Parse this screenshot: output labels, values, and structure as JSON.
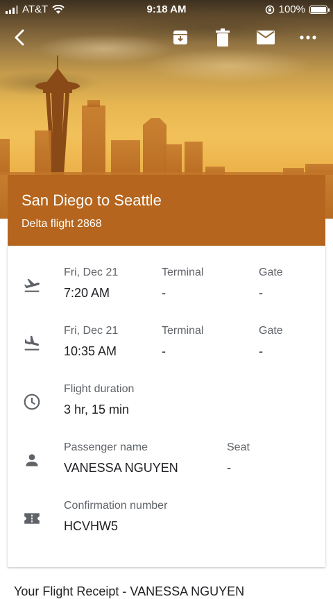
{
  "status_bar": {
    "carrier": "AT&T",
    "time": "9:18 AM",
    "battery": "100%"
  },
  "toolbar": {
    "back_icon": "back-arrow-icon",
    "archive_icon": "archive-icon",
    "delete_icon": "trash-icon",
    "mail_icon": "mail-icon",
    "more_icon": "more-icon"
  },
  "card": {
    "title": "San Diego to Seattle",
    "subtitle": "Delta flight 2868",
    "header_color": "#b5651d",
    "departure": {
      "date": "Fri, Dec 21",
      "time": "7:20 AM",
      "terminal_label": "Terminal",
      "terminal": "-",
      "gate_label": "Gate",
      "gate": "-"
    },
    "arrival": {
      "date": "Fri, Dec 21",
      "time": "10:35 AM",
      "terminal_label": "Terminal",
      "terminal": "-",
      "gate_label": "Gate",
      "gate": "-"
    },
    "duration": {
      "label": "Flight duration",
      "value": "3 hr, 15 min"
    },
    "passenger": {
      "label": "Passenger name",
      "name": "VANESSA NGUYEN",
      "seat_label": "Seat",
      "seat": "-"
    },
    "confirmation": {
      "label": "Confirmation number",
      "value": "HCVHW5"
    }
  },
  "email_preview": "Your Flight Receipt - VANESSA NGUYEN"
}
